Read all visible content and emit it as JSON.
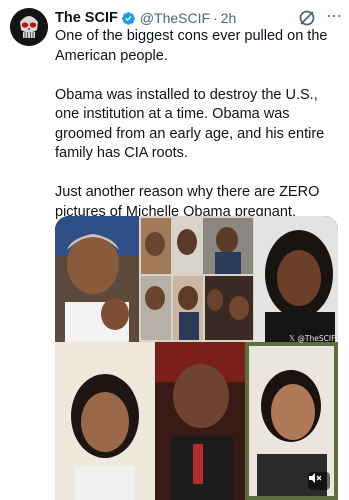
{
  "tweet": {
    "author_name": "The SCIF",
    "handle": "@TheSCIF",
    "separator": "·",
    "time": "2h",
    "text": "One of the biggest cons ever pulled on the American people.\n\nObama was installed to destroy the U.S., one institution at a time. Obama was groomed from an early age, and his entire family has CIA roots.\n\nJust another reason why there are ZERO pictures of Michelle Obama pregnant."
  },
  "media": {
    "watermark": "𝕏 @TheSCIF"
  },
  "colors": {
    "verified": "#1d9bf0",
    "secondary_text": "#536471",
    "primary_text": "#0f1419"
  },
  "icons": {
    "avatar": "punisher-skull-avatar",
    "verified": "verified-badge-icon",
    "grok": "grok-icon",
    "more": "more-options-icon",
    "mute": "volume-muted-icon"
  }
}
